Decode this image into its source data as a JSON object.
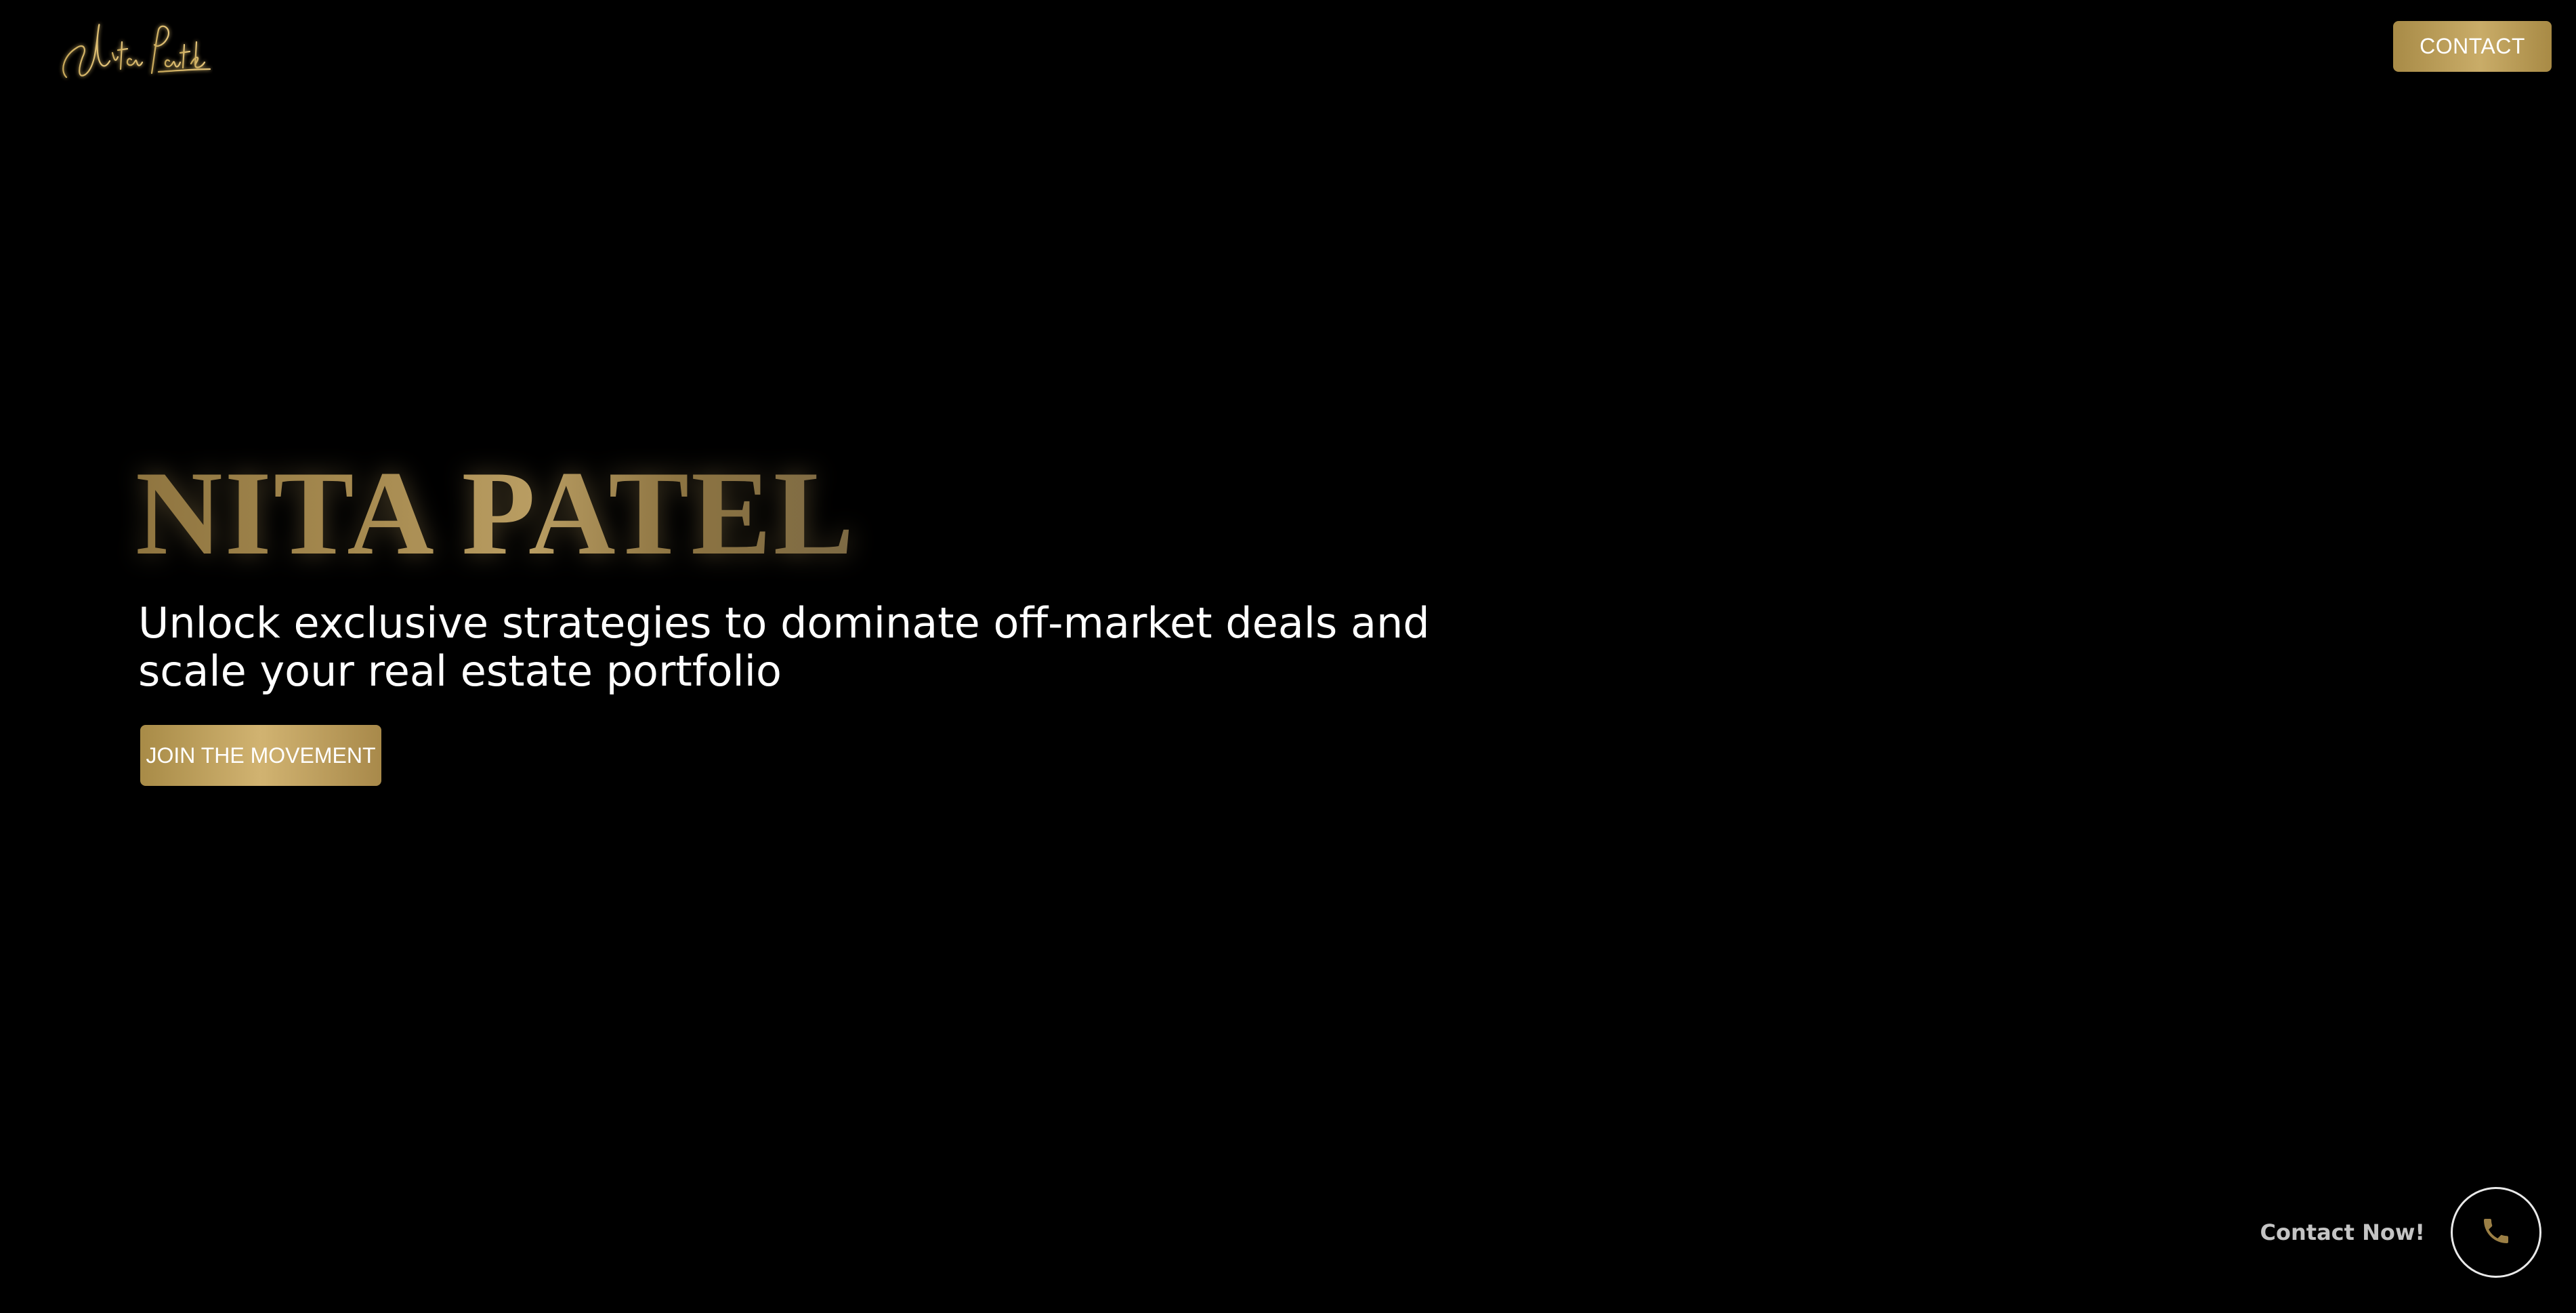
{
  "header": {
    "logo_text": "Nita Patel",
    "contact_label": "CONTACT"
  },
  "hero": {
    "title": "NITA PATEL",
    "subtitle": "Unlock exclusive strategies to dominate off-market deals and scale your real estate portfolio",
    "cta_label": "JOIN THE MOVEMENT"
  },
  "floating_contact": {
    "label": "Contact Now!",
    "icon": "phone-icon"
  },
  "colors": {
    "background": "#000000",
    "gold": "#b89b5e",
    "text": "#ffffff"
  }
}
